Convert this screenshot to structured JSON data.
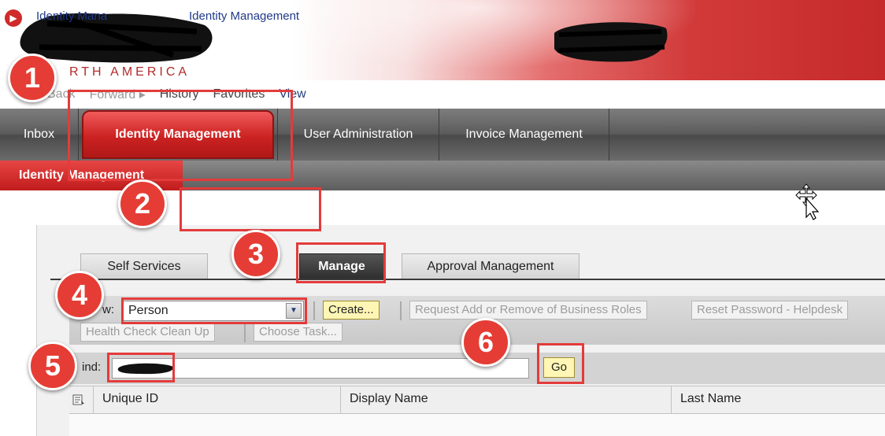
{
  "header": {
    "brand_text": "RTH AMERICA"
  },
  "navbar": {
    "back_label": "Back",
    "forward_label": "Forward ▸",
    "history_label": "History",
    "favorites_label": "Favorites",
    "view_label": "View"
  },
  "top_tabs": [
    "Inbox",
    "Identity Management",
    "User Administration",
    "Invoice Management"
  ],
  "active_top_tab": "Identity Management",
  "sub_tab": "Identity Management",
  "breadcrumb": {
    "first": "Identity Mana",
    "second": "Identity Management"
  },
  "content_tabs": [
    "Self Services",
    "Manage",
    "Approval Management"
  ],
  "active_content_tab": "Manage",
  "toolbar": {
    "view_label": "w:",
    "view_value": "Person",
    "create_label": "Create...",
    "request_roles_label": "Request Add or Remove of Business Roles",
    "reset_password_label": "Reset Password - Helpdesk",
    "health_check_label": "Health Check Clean Up",
    "choose_task_label": "Choose Task..."
  },
  "find": {
    "label": "ind:",
    "value": "",
    "go_label": "Go"
  },
  "table": {
    "columns": [
      "Unique ID",
      "Display Name",
      "Last Name"
    ]
  },
  "annotations": {
    "steps": [
      "1",
      "2",
      "3",
      "4",
      "5",
      "6"
    ],
    "color": "#e33b3b"
  },
  "colors": {
    "brand_red": "#cc2222",
    "link_blue": "#203a8a",
    "primary_button": "#fff6b5"
  }
}
